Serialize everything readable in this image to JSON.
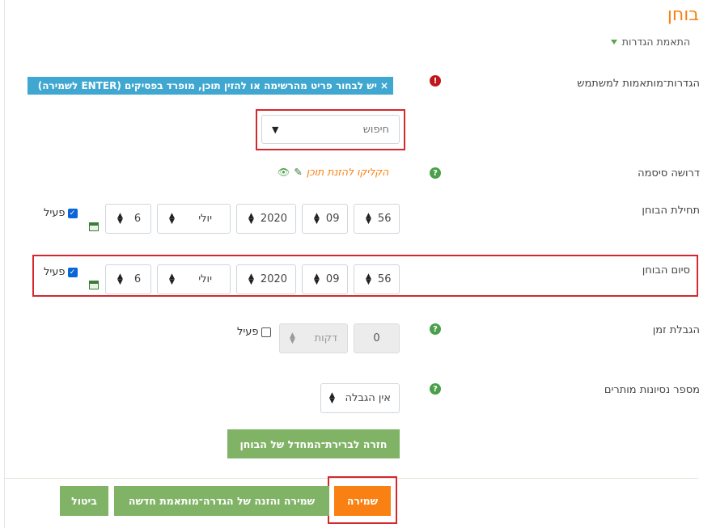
{
  "page": {
    "title": "בוחן"
  },
  "section": {
    "collapse_label": "התאמת הגדרות"
  },
  "user_override": {
    "label": "הגדרות־מותאמות למשתמש",
    "error_icon": "!",
    "tag_text": "יש לבחור פריט מהרשימה או להזין תוכן, מופרד בפסיקים (ENTER לשמירה)",
    "tag_close": "×",
    "search_placeholder": "חיפוש",
    "dropdown_arrow": "▼"
  },
  "password": {
    "label": "דרושה סיסמה",
    "help_icon": "?",
    "edit_link": "הקליקו להזנת תוכן",
    "pencil_icon": "✎",
    "eye_icon": "👁"
  },
  "open_date": {
    "label": "תחילת הבוחן",
    "minute": "56",
    "hour": "09",
    "year": "2020",
    "month": "יולי",
    "day": "6",
    "enabled_label": "פעיל",
    "enabled": true
  },
  "close_date": {
    "label": "סיום הבוחן",
    "minute": "56",
    "hour": "09",
    "year": "2020",
    "month": "יולי",
    "day": "6",
    "enabled_label": "פעיל",
    "enabled": true
  },
  "time_limit": {
    "label": "הגבלת זמן",
    "help_icon": "?",
    "value": "0",
    "unit": "דקות",
    "enabled_label": "פעיל",
    "enabled": false
  },
  "attempts": {
    "label": "מספר נסיונות מותרים",
    "help_icon": "?",
    "value": "אין הגבלה"
  },
  "buttons": {
    "back": "חזרה לברירת־המחדל של הבוחן",
    "save": "שמירה",
    "save_and_new": "שמירה והזנה של הגדרה־מותאמת חדשה",
    "cancel": "ביטול"
  },
  "colors": {
    "accent": "#f98012",
    "green": "#81b366",
    "tag": "#3fa7d0",
    "highlight": "#d5282e"
  }
}
